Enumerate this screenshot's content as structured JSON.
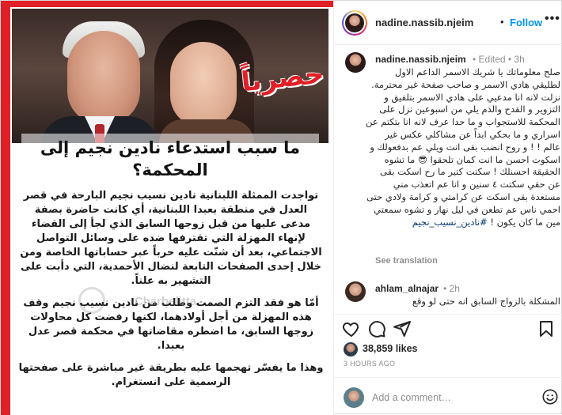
{
  "image": {
    "badge": "حصرياً",
    "headline": "ما سبب استدعاء نادين نجيم إلى المحكمة؟",
    "paragraphs": [
      "تواجدت الممثلة اللبنانية نادين نسيب نجيم البارحة في قصر العدل في منطقة بعبدا اللبنانية، أي كانت حاضرة بصفة مدعى عليها من قبل زوجها السابق الذي لجأ إلى القضاء لإنهاء المهزلة التي تقترفها ضده على وسائل التواصل الاجتماعي، بعد أن شنّت عليه حرباً عبر حساباتها الخاصة ومن خلال إحدى الصفحات التابعة لنضال الأحمدية، التي دأبت على التشهير به علناً.",
      "أمّا هو فقد التزم الصمت وطلب من نادين نسيب نجيم وقف هذه المهزلة من أجل أولادهما، لكنها رفضت كل محاولات زوجها السابق، ما اضطره مقاضاتها في محكمة قصر عدل بعبدا.",
      "وهذا ما يفسّر تهجمها عليه بطريقة غير مباشرة على صفحتها الرسمية على انستغرام."
    ],
    "watermark": "Charbelitta"
  },
  "header": {
    "username": "nadine.nassib.njeim",
    "separator": "•",
    "follow_label": "Follow",
    "more_label": "•••"
  },
  "caption": {
    "username": "nadine.nassib.njeim",
    "meta": "• Edited • 3h",
    "text": "صلح معلوماتك يا شريك الاسمر الداعم الاول لطليقي هادي الاسمر و صاحب صفحة غير محترمة. نزلت لانه انا مدعيي على هادي الاسمر بتلفيق و التزوير و القدح والذم يلي من اسبوعين نزل على المحكمة للاستجواب و ما حدا عرف لانه انا بتكتم عن اسراري و ما بحكي ابداً عن مشاكلي عكس غير عالم ! ! و روح انضب بقى انت ويلي عم بدفعولك و اسكوت احسن ما انت كمان تلحقوا 😎 ما تشوه الحقيقة احسنلك ! سكتت كتير ما رح اسكت بقى عن حقي سكتت ٤ سنين و انا عم اتعذب مني مستعدة بقى اسكت عن كرامتي و كرامة ولادي حتى احمي ناس عم تطعن في ليل نهار و تشوه سمعتي مين ما كان يكون !",
    "hashtag": "#نادين_نسيب_نجيم",
    "see_translation": "See translation"
  },
  "comment2": {
    "username": "ahlam_alnajar",
    "meta": "• 2h",
    "text": "المشكلة بالزواج السابق انه حتى لو وقع"
  },
  "actions": {
    "likes": "38,859 likes",
    "time_ago": "3 HOURS AGO",
    "comment_placeholder": "Add a comment…"
  },
  "colors": {
    "accent": "#0095f6",
    "red": "#e11f26",
    "muted": "#8e8e8e"
  }
}
